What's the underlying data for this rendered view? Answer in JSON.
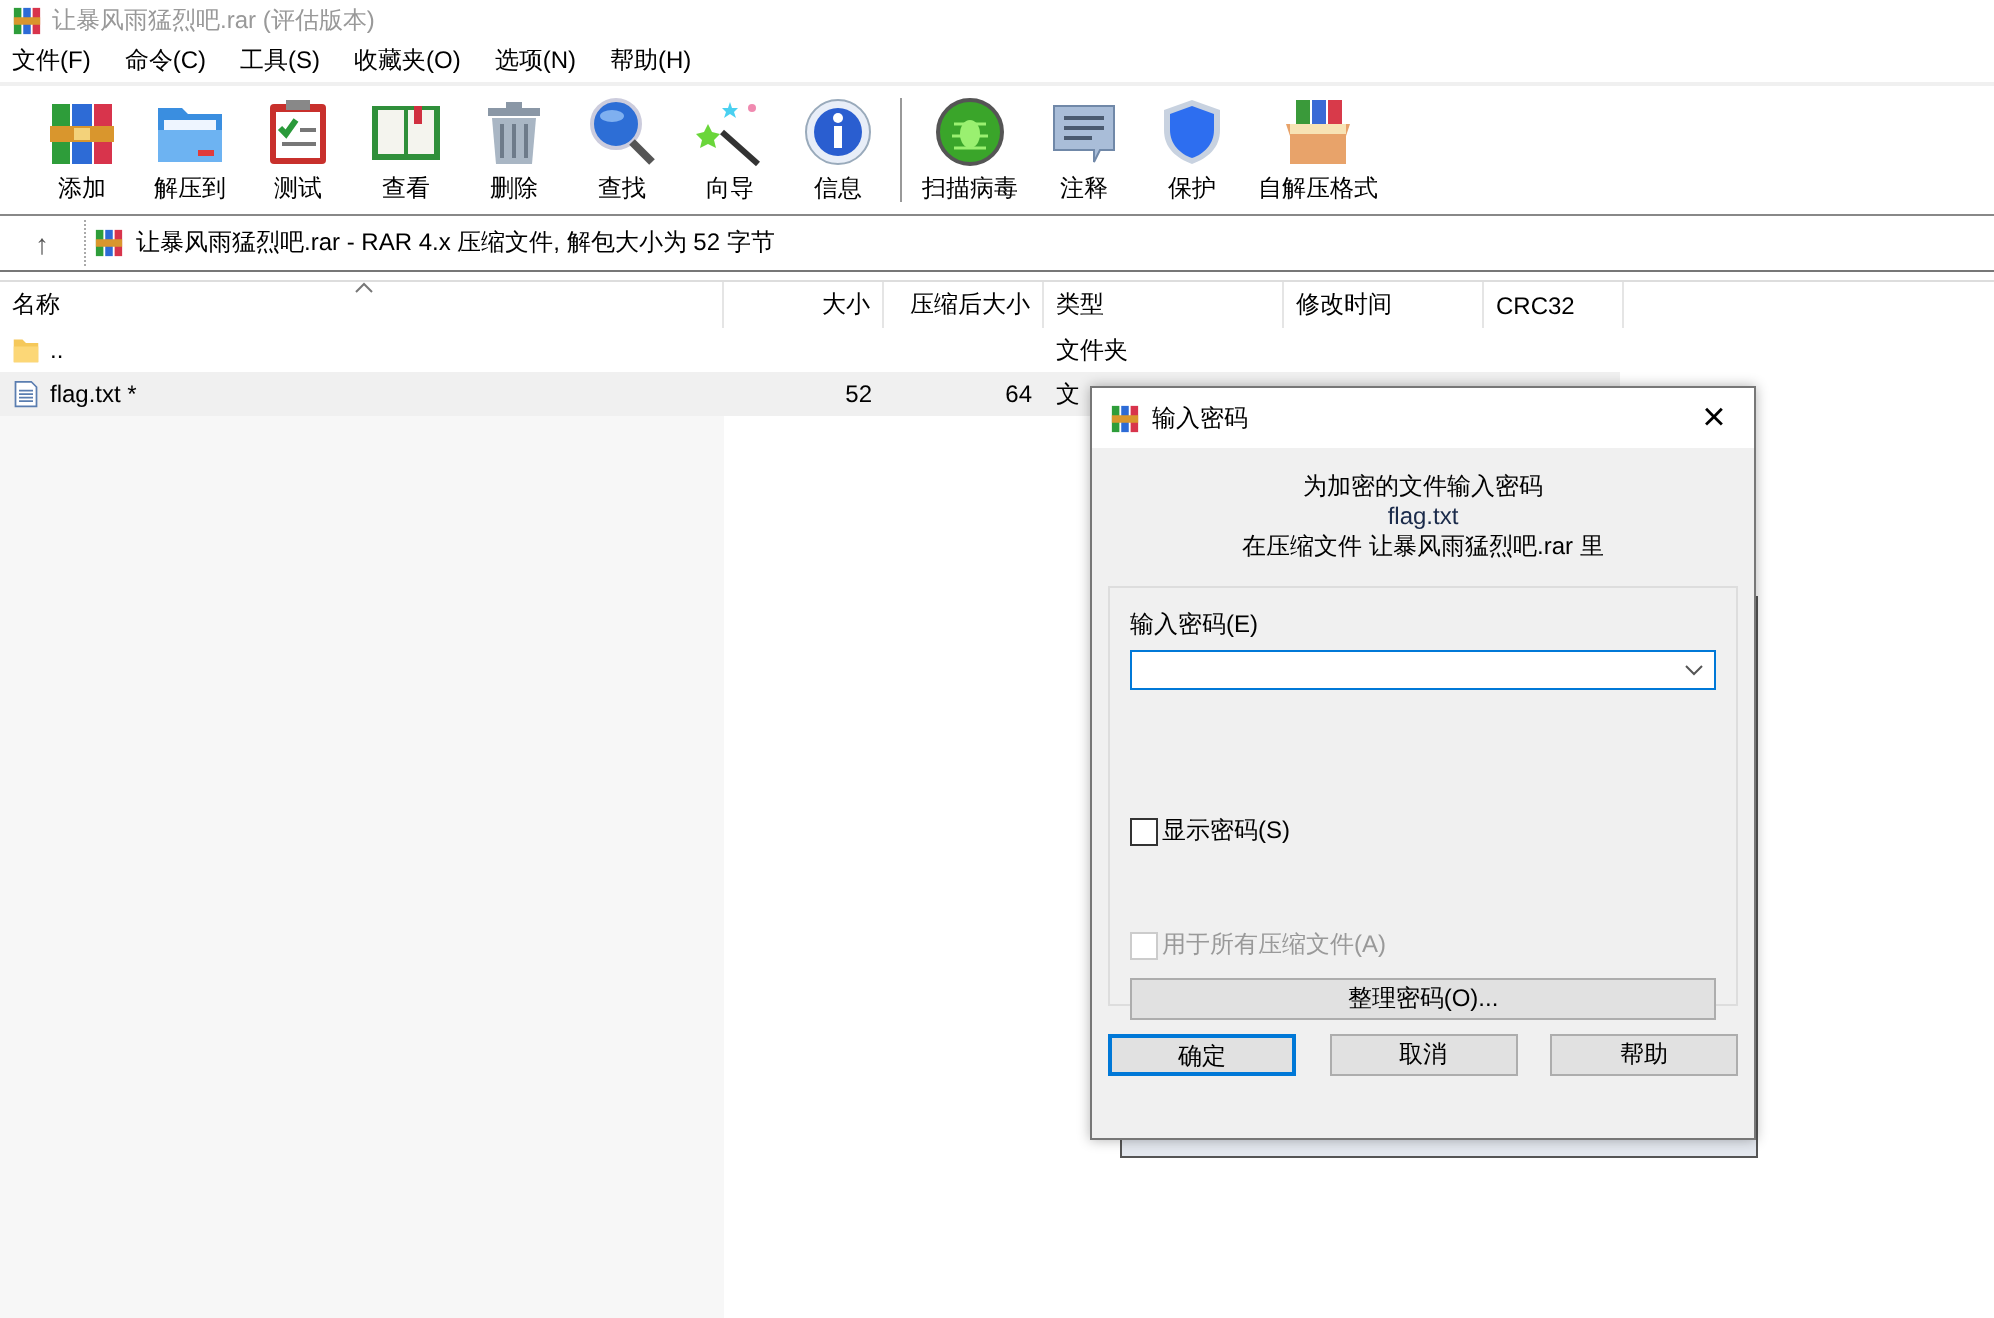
{
  "window": {
    "title": "让暴风雨猛烈吧.rar (评估版本)"
  },
  "menu": [
    "文件(F)",
    "命令(C)",
    "工具(S)",
    "收藏夹(O)",
    "选项(N)",
    "帮助(H)"
  ],
  "toolbar": [
    {
      "label": "添加"
    },
    {
      "label": "解压到"
    },
    {
      "label": "测试"
    },
    {
      "label": "查看"
    },
    {
      "label": "删除"
    },
    {
      "label": "查找"
    },
    {
      "label": "向导"
    },
    {
      "label": "信息"
    },
    {
      "label": "扫描病毒"
    },
    {
      "label": "注释"
    },
    {
      "label": "保护"
    },
    {
      "label": "自解压格式"
    }
  ],
  "address": {
    "up": "↑",
    "path": "让暴风雨猛烈吧.rar - RAR 4.x 压缩文件, 解包大小为 52 字节"
  },
  "table": {
    "columns": [
      "名称",
      "大小",
      "压缩后大小",
      "类型",
      "修改时间",
      "CRC32"
    ],
    "rows": [
      {
        "kind": "folder",
        "name": "..",
        "size": "",
        "packed": "",
        "type": "文件夹",
        "selected": false
      },
      {
        "kind": "file",
        "name": "flag.txt *",
        "size": "52",
        "packed": "64",
        "type": "文",
        "selected": true
      }
    ]
  },
  "dialog": {
    "title": "输入密码",
    "close": "×",
    "line1": "为加密的文件输入密码",
    "file": "flag.txt",
    "line3": "在压缩文件 让暴风雨猛烈吧.rar 里",
    "password_label": "输入密码(E)",
    "show_password": {
      "label": "显示密码(S)",
      "checked": false,
      "disabled": false
    },
    "all_archives": {
      "label": "用于所有压缩文件(A)",
      "checked": false,
      "disabled": true
    },
    "organize": "整理密码(O)...",
    "buttons": [
      {
        "label": "确定",
        "default": true
      },
      {
        "label": "取消",
        "default": false
      },
      {
        "label": "帮助",
        "default": false
      }
    ]
  }
}
